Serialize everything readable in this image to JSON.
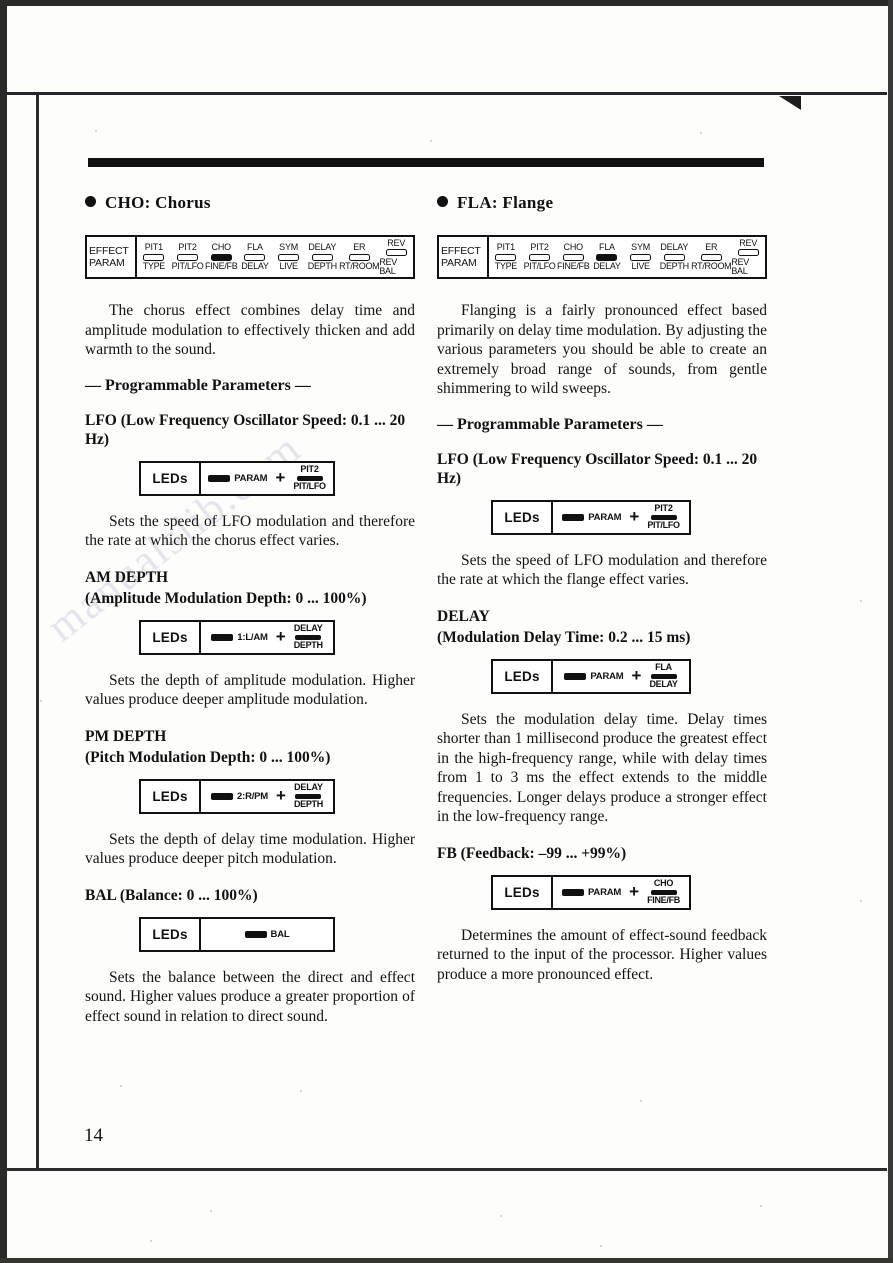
{
  "page": {
    "folio": "14",
    "watermark": "manualslib.com"
  },
  "panel_strip": {
    "row_labels": {
      "top": "EFFECT",
      "bottom": "PARAM"
    },
    "cells": [
      {
        "top": "PIT1",
        "bottom": "TYPE",
        "led": "off"
      },
      {
        "top": "PIT2",
        "bottom": "PIT/LFO",
        "led": "off"
      },
      {
        "top": "CHO",
        "bottom": "FINE/FB",
        "led": "off"
      },
      {
        "top": "FLA",
        "bottom": "DELAY",
        "led": "off"
      },
      {
        "top": "SYM",
        "bottom": "LIVE",
        "led": "off"
      },
      {
        "top": "DELAY",
        "bottom": "DEPTH",
        "led": "off"
      },
      {
        "top": "ER",
        "bottom": "RT/ROOM",
        "led": "off"
      },
      {
        "top": "REV",
        "bottom": "REV BAL",
        "led": "off"
      }
    ]
  },
  "left_column": {
    "heading": "CHO: Chorus",
    "active_led_index": 2,
    "intro": "The chorus effect combines delay time and amplitude modulation to effectively thicken and add warmth to the sound.",
    "programmable_heading": "— Programmable Parameters —",
    "params": [
      {
        "title": "LFO (Low Frequency Oscillator Speed: 0.1 ... 20 Hz)",
        "subtitle": "",
        "led_box": {
          "label": "LEDs",
          "first": {
            "type": "bar-text",
            "text": "PARAM"
          },
          "operator": "+",
          "second": {
            "type": "stack",
            "top": "PIT2",
            "bottom": "PIT/LFO"
          }
        },
        "description": "Sets the speed of LFO modulation and therefore the rate at which the chorus effect varies."
      },
      {
        "title": "AM DEPTH",
        "subtitle": "(Amplitude Modulation Depth: 0 ... 100%)",
        "led_box": {
          "label": "LEDs",
          "first": {
            "type": "bar-text",
            "text": "1:L/AM"
          },
          "operator": "+",
          "second": {
            "type": "stack",
            "top": "DELAY",
            "bottom": "DEPTH"
          }
        },
        "description": "Sets the depth of amplitude modulation. Higher values produce deeper amplitude modulation."
      },
      {
        "title": "PM DEPTH",
        "subtitle": "(Pitch Modulation Depth: 0 ... 100%)",
        "led_box": {
          "label": "LEDs",
          "first": {
            "type": "bar-text",
            "text": "2:R/PM"
          },
          "operator": "+",
          "second": {
            "type": "stack",
            "top": "DELAY",
            "bottom": "DEPTH"
          }
        },
        "description": "Sets the depth of delay time modulation. Higher values produce deeper pitch modulation."
      },
      {
        "title": "BAL (Balance: 0 ... 100%)",
        "subtitle": "",
        "led_box": {
          "label": "LEDs",
          "first": {
            "type": "bar-text",
            "text": "BAL"
          },
          "operator": "",
          "second": null
        },
        "description": "Sets the balance between the direct and effect sound. Higher values produce a greater proportion of effect sound in relation to direct sound."
      }
    ]
  },
  "right_column": {
    "heading": "FLA: Flange",
    "active_led_index": 3,
    "intro": "Flanging is a fairly pronounced effect based primarily on delay time modulation. By adjusting the various parameters you should be able to create an extremely broad range of sounds, from gentle shimmering to wild sweeps.",
    "programmable_heading": "— Programmable Parameters —",
    "params": [
      {
        "title": "LFO (Low Frequency Oscillator Speed: 0.1 ... 20 Hz)",
        "subtitle": "",
        "led_box": {
          "label": "LEDs",
          "first": {
            "type": "bar-text",
            "text": "PARAM"
          },
          "operator": "+",
          "second": {
            "type": "stack",
            "top": "PIT2",
            "bottom": "PIT/LFO"
          }
        },
        "description": "Sets the speed of LFO modulation and therefore the rate at which the flange effect varies."
      },
      {
        "title": "DELAY",
        "subtitle": "(Modulation Delay Time: 0.2 ... 15 ms)",
        "led_box": {
          "label": "LEDs",
          "first": {
            "type": "bar-text",
            "text": "PARAM"
          },
          "operator": "+",
          "second": {
            "type": "stack",
            "top": "FLA",
            "bottom": "DELAY"
          }
        },
        "description": "Sets the modulation delay time. Delay times shorter than 1 millisecond produce the greatest effect in the high-frequency range, while with delay times from 1 to 3 ms the effect extends to the middle frequencies. Longer delays produce a stronger effect in the low-frequency range."
      },
      {
        "title": "FB (Feedback: –99 ... +99%)",
        "subtitle": "",
        "led_box": {
          "label": "LEDs",
          "first": {
            "type": "bar-text",
            "text": "PARAM"
          },
          "operator": "+",
          "second": {
            "type": "stack",
            "top": "CHO",
            "bottom": "FINE/FB"
          }
        },
        "description": "Determines the amount of effect-sound feedback returned to the input of the processor. Higher values produce a more pronounced effect."
      }
    ]
  }
}
